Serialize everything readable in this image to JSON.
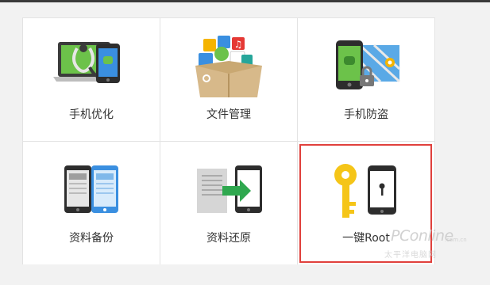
{
  "tiles": [
    {
      "label": "手机优化",
      "icon": "phone-optimize-icon"
    },
    {
      "label": "文件管理",
      "icon": "file-manager-icon"
    },
    {
      "label": "手机防盗",
      "icon": "phone-antitheft-icon"
    },
    {
      "label": "资料备份",
      "icon": "data-backup-icon"
    },
    {
      "label": "资料还原",
      "icon": "data-restore-icon"
    },
    {
      "label": "一键Root",
      "icon": "one-click-root-icon"
    }
  ],
  "highlight_color": "#e0403c",
  "watermark": {
    "brand": "PConline",
    "domain": ".com.cn",
    "tagline": "太平洋电脑网"
  }
}
